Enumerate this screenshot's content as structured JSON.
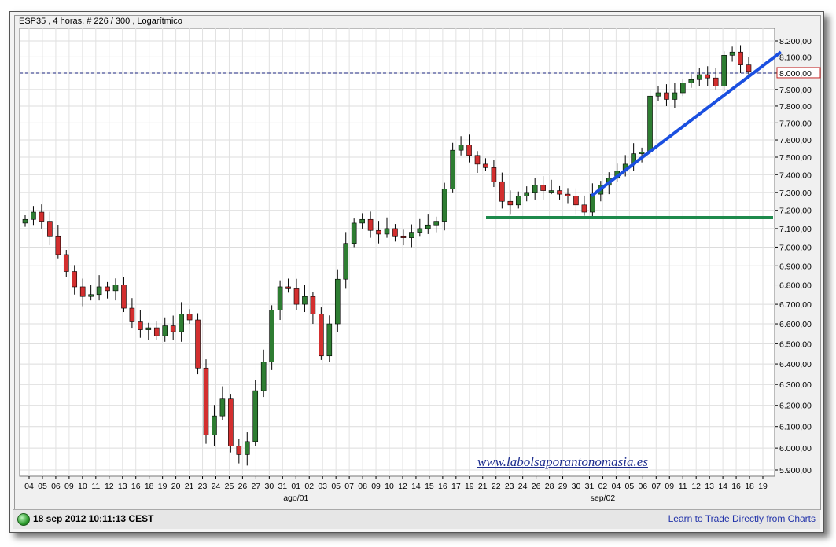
{
  "header": {
    "title": "ESP35 , 4 horas, # 226 / 300 , Logarítmico"
  },
  "watermark": "www.labolsaporantonomasia.es",
  "status": {
    "timestamp": "18 sep 2012 10:11:13 CEST",
    "link_label": "Learn to Trade Directly from Charts",
    "led_color": "#2e9d2e"
  },
  "chart_data": {
    "type": "candlestick",
    "title": "ESP35 , 4 horas, # 226 / 300 , Logarítmico",
    "scale": "log",
    "grid": true,
    "ylim": [
      5850,
      8300
    ],
    "y_ticks": [
      "8.200,00",
      "8.100,00",
      "8.000,00",
      "7.900,00",
      "7.800,00",
      "7.700,00",
      "7.600,00",
      "7.500,00",
      "7.400,00",
      "7.300,00",
      "7.200,00",
      "7.100,00",
      "7.000,00",
      "6.900,00",
      "6.800,00",
      "6.700,00",
      "6.600,00",
      "6.500,00",
      "6.400,00",
      "6.300,00",
      "6.200,00",
      "6.100,00",
      "6.000,00",
      "5.900,00"
    ],
    "y_tick_values": [
      8200,
      8100,
      8000,
      7900,
      7800,
      7700,
      7600,
      7500,
      7400,
      7300,
      7200,
      7100,
      7000,
      6900,
      6800,
      6700,
      6600,
      6500,
      6400,
      6300,
      6200,
      6100,
      6000,
      5900
    ],
    "x_ticks": [
      "04",
      "05",
      "06",
      "09",
      "10",
      "11",
      "12",
      "13",
      "16",
      "18",
      "19",
      "20",
      "21",
      "23",
      "24",
      "25",
      "26",
      "27",
      "30",
      "31",
      "01",
      "02",
      "03",
      "06",
      "07",
      "08",
      "09",
      "10",
      "13",
      "14",
      "15",
      "16",
      "17",
      "20",
      "21",
      "22",
      "23",
      "24",
      "27",
      "28",
      "29",
      "30",
      "31",
      "03",
      "04",
      "05",
      "06",
      "07",
      "10",
      "11",
      "12",
      "13",
      "14",
      "17",
      "18",
      "19"
    ],
    "x_ticks_shown": [
      "04",
      "05",
      "06",
      "09",
      "10",
      "11",
      "12",
      "13",
      "16",
      "18",
      "19",
      "20",
      "21",
      "23",
      "24",
      "25",
      "26",
      "27",
      "30",
      "31",
      "01",
      "02",
      "03",
      "05",
      "07",
      "08",
      "09",
      "10",
      "12",
      "14",
      "15",
      "16",
      "17",
      "19",
      "21",
      "22",
      "23",
      "24",
      "26",
      "28",
      "29",
      "30",
      "31",
      "02",
      "04",
      "05",
      "06",
      "07",
      "09",
      "11",
      "12",
      "13",
      "14",
      "16",
      "18",
      "19"
    ],
    "x_month_labels": [
      {
        "label": "ago/01",
        "at_tick": "01"
      },
      {
        "label": "sep/02",
        "at_tick": "02"
      }
    ],
    "reference_line": {
      "value": "8.000,00",
      "style": "dashed",
      "color": "#1a237e"
    },
    "support_line": {
      "value": 7160,
      "color": "#1e8a4c"
    },
    "trend_line": {
      "from_value": 7280,
      "to_value": 8130,
      "color": "#1a4fe0"
    },
    "candles_close": [
      7150,
      7190,
      7140,
      7060,
      6960,
      6870,
      6790,
      6740,
      6750,
      6790,
      6770,
      6800,
      6680,
      6610,
      6570,
      6580,
      6540,
      6590,
      6560,
      6650,
      6620,
      6380,
      6060,
      6150,
      6230,
      6010,
      5970,
      6030,
      6270,
      6410,
      6670,
      6790,
      6780,
      6700,
      6740,
      6650,
      6440,
      6600,
      6830,
      7020,
      7130,
      7150,
      7090,
      7070,
      7100,
      7060,
      7050,
      7080,
      7100,
      7120,
      7140,
      7320,
      7540,
      7570,
      7510,
      7460,
      7440,
      7360,
      7250,
      7230,
      7280,
      7300,
      7340,
      7310,
      7310,
      7290,
      7280,
      7230,
      7190,
      7290,
      7340,
      7380,
      7420,
      7460,
      7520,
      7530,
      7860,
      7880,
      7840,
      7880,
      7940,
      7960,
      7990,
      7970,
      7920,
      8110,
      8130,
      8050,
      8010
    ]
  }
}
